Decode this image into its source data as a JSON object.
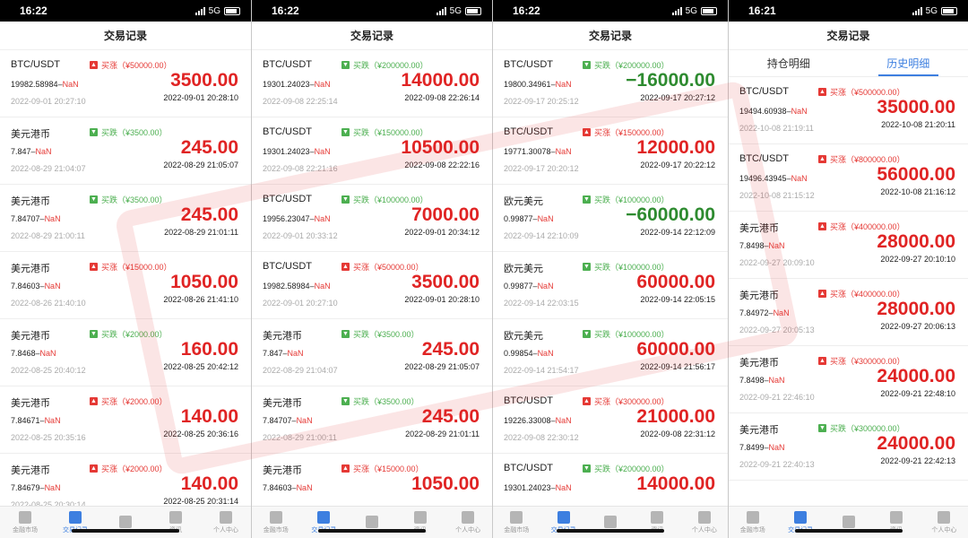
{
  "nav": {
    "items": [
      {
        "label": "金融市场"
      },
      {
        "label": "交易记录"
      },
      {
        "label": ""
      },
      {
        "label": "资讯"
      },
      {
        "label": "个人中心"
      }
    ]
  },
  "panels": [
    {
      "time": "16:22",
      "network": "5G",
      "title": "交易记录",
      "records": [
        {
          "symbol": "BTC/USDT",
          "dir": "up",
          "dir_label": "买涨（¥50000.00）",
          "price": "19982.58984",
          "nan": "NaN",
          "open_time": "2022-09-01 20:27:10",
          "amount": "3500.00",
          "close_time": "2022-09-01 20:28:10"
        },
        {
          "symbol": "美元港币",
          "dir": "down",
          "dir_label": "买跌（¥3500.00）",
          "price": "7.847",
          "nan": "NaN",
          "open_time": "2022-08-29 21:04:07",
          "amount": "245.00",
          "close_time": "2022-08-29 21:05:07"
        },
        {
          "symbol": "美元港币",
          "dir": "down",
          "dir_label": "买跌（¥3500.00）",
          "price": "7.84707",
          "nan": "NaN",
          "open_time": "2022-08-29 21:00:11",
          "amount": "245.00",
          "close_time": "2022-08-29 21:01:11"
        },
        {
          "symbol": "美元港币",
          "dir": "up",
          "dir_label": "买涨（¥15000.00）",
          "price": "7.84603",
          "nan": "NaN",
          "open_time": "2022-08-26 21:40:10",
          "amount": "1050.00",
          "close_time": "2022-08-26 21:41:10"
        },
        {
          "symbol": "美元港币",
          "dir": "down",
          "dir_label": "买跌（¥2000.00）",
          "price": "7.8468",
          "nan": "NaN",
          "open_time": "2022-08-25 20:40:12",
          "amount": "160.00",
          "close_time": "2022-08-25 20:42:12"
        },
        {
          "symbol": "美元港币",
          "dir": "up",
          "dir_label": "买涨（¥2000.00）",
          "price": "7.84671",
          "nan": "NaN",
          "open_time": "2022-08-25 20:35:16",
          "amount": "140.00",
          "close_time": "2022-08-25 20:36:16"
        },
        {
          "symbol": "美元港币",
          "dir": "up",
          "dir_label": "买涨（¥2000.00）",
          "price": "7.84679",
          "nan": "NaN",
          "open_time": "2022-08-25 20:30:14",
          "amount": "140.00",
          "close_time": "2022-08-25 20:31:14"
        }
      ]
    },
    {
      "time": "16:22",
      "network": "5G",
      "title": "交易记录",
      "records": [
        {
          "symbol": "BTC/USDT",
          "dir": "down",
          "dir_label": "买跌（¥200000.00）",
          "price": "19301.24023",
          "nan": "NaN",
          "open_time": "2022-09-08 22:25:14",
          "amount": "14000.00",
          "close_time": "2022-09-08 22:26:14"
        },
        {
          "symbol": "BTC/USDT",
          "dir": "down",
          "dir_label": "买跌（¥150000.00）",
          "price": "19301.24023",
          "nan": "NaN",
          "open_time": "2022-09-08 22:21:16",
          "amount": "10500.00",
          "close_time": "2022-09-08 22:22:16"
        },
        {
          "symbol": "BTC/USDT",
          "dir": "down",
          "dir_label": "买跌（¥100000.00）",
          "price": "19956.23047",
          "nan": "NaN",
          "open_time": "2022-09-01 20:33:12",
          "amount": "7000.00",
          "close_time": "2022-09-01 20:34:12"
        },
        {
          "symbol": "BTC/USDT",
          "dir": "up",
          "dir_label": "买涨（¥50000.00）",
          "price": "19982.58984",
          "nan": "NaN",
          "open_time": "2022-09-01 20:27:10",
          "amount": "3500.00",
          "close_time": "2022-09-01 20:28:10"
        },
        {
          "symbol": "美元港币",
          "dir": "down",
          "dir_label": "买跌（¥3500.00）",
          "price": "7.847",
          "nan": "NaN",
          "open_time": "2022-08-29 21:04:07",
          "amount": "245.00",
          "close_time": "2022-08-29 21:05:07"
        },
        {
          "symbol": "美元港币",
          "dir": "down",
          "dir_label": "买跌（¥3500.00）",
          "price": "7.84707",
          "nan": "NaN",
          "open_time": "2022-08-29 21:00:11",
          "amount": "245.00",
          "close_time": "2022-08-29 21:01:11"
        },
        {
          "symbol": "美元港币",
          "dir": "up",
          "dir_label": "买涨（¥15000.00）",
          "price": "7.84603",
          "nan": "NaN",
          "open_time": "",
          "amount": "1050.00",
          "close_time": ""
        }
      ]
    },
    {
      "time": "16:22",
      "network": "5G",
      "title": "交易记录",
      "records": [
        {
          "symbol": "BTC/USDT",
          "dir": "down",
          "dir_label": "买跌（¥200000.00）",
          "price": "19800.34961",
          "nan": "NaN",
          "open_time": "2022-09-17 20:25:12",
          "amount": "−16000.00",
          "neg": true,
          "close_time": "2022-09-17 20:27:12"
        },
        {
          "symbol": "BTC/USDT",
          "dir": "up",
          "dir_label": "买涨（¥150000.00）",
          "price": "19771.30078",
          "nan": "NaN",
          "open_time": "2022-09-17 20:20:12",
          "amount": "12000.00",
          "close_time": "2022-09-17 20:22:12"
        },
        {
          "symbol": "欧元美元",
          "dir": "down",
          "dir_label": "买跌（¥100000.00）",
          "price": "0.99877",
          "nan": "NaN",
          "open_time": "2022-09-14 22:10:09",
          "amount": "−60000.00",
          "neg": true,
          "close_time": "2022-09-14 22:12:09"
        },
        {
          "symbol": "欧元美元",
          "dir": "down",
          "dir_label": "买跌（¥100000.00）",
          "price": "0.99877",
          "nan": "NaN",
          "open_time": "2022-09-14 22:03:15",
          "amount": "60000.00",
          "close_time": "2022-09-14 22:05:15"
        },
        {
          "symbol": "欧元美元",
          "dir": "down",
          "dir_label": "买跌（¥100000.00）",
          "price": "0.99854",
          "nan": "NaN",
          "open_time": "2022-09-14 21:54:17",
          "amount": "60000.00",
          "close_time": "2022-09-14 21:56:17"
        },
        {
          "symbol": "BTC/USDT",
          "dir": "up",
          "dir_label": "买涨（¥300000.00）",
          "price": "19226.33008",
          "nan": "NaN",
          "open_time": "2022-09-08 22:30:12",
          "amount": "21000.00",
          "close_time": "2022-09-08 22:31:12"
        },
        {
          "symbol": "BTC/USDT",
          "dir": "down",
          "dir_label": "买跌（¥200000.00）",
          "price": "19301.24023",
          "nan": "NaN",
          "open_time": "",
          "amount": "14000.00",
          "close_time": ""
        }
      ]
    },
    {
      "time": "16:21",
      "network": "5G",
      "title": "交易记录",
      "tabs": [
        "持仓明细",
        "历史明细"
      ],
      "records": [
        {
          "symbol": "BTC/USDT",
          "dir": "up",
          "dir_label": "买涨（¥500000.00）",
          "price": "19494.60938",
          "nan": "NaN",
          "open_time": "2022-10-08 21:19:11",
          "amount": "35000.00",
          "close_time": "2022-10-08 21:20:11"
        },
        {
          "symbol": "BTC/USDT",
          "dir": "up",
          "dir_label": "买涨（¥800000.00）",
          "price": "19496.43945",
          "nan": "NaN",
          "open_time": "2022-10-08 21:15:12",
          "amount": "56000.00",
          "close_time": "2022-10-08 21:16:12"
        },
        {
          "symbol": "美元港币",
          "dir": "up",
          "dir_label": "买涨（¥400000.00）",
          "price": "7.8498",
          "nan": "NaN",
          "open_time": "2022-09-27 20:09:10",
          "amount": "28000.00",
          "close_time": "2022-09-27 20:10:10"
        },
        {
          "symbol": "美元港币",
          "dir": "up",
          "dir_label": "买涨（¥400000.00）",
          "price": "7.84972",
          "nan": "NaN",
          "open_time": "2022-09-27 20:05:13",
          "amount": "28000.00",
          "close_time": "2022-09-27 20:06:13"
        },
        {
          "symbol": "美元港币",
          "dir": "up",
          "dir_label": "买涨（¥300000.00）",
          "price": "7.8498",
          "nan": "NaN",
          "open_time": "2022-09-21 22:46:10",
          "amount": "24000.00",
          "close_time": "2022-09-21 22:48:10"
        },
        {
          "symbol": "美元港币",
          "dir": "down",
          "dir_label": "买跌（¥300000.00）",
          "price": "7.8499",
          "nan": "NaN",
          "open_time": "2022-09-21 22:40:13",
          "amount": "24000.00",
          "close_time": "2022-09-21 22:42:13"
        }
      ]
    }
  ]
}
